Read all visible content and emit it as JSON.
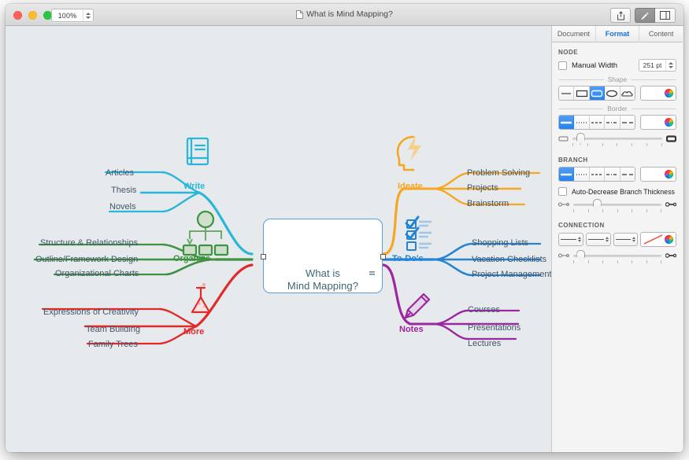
{
  "window": {
    "title": "What is Mind Mapping?",
    "zoom": "100%",
    "doc_icon": "document-icon",
    "traffic_lights": [
      "close",
      "minimize",
      "zoom"
    ],
    "toolbar_buttons": [
      {
        "name": "share-button",
        "icon": "share-icon",
        "active": false
      },
      {
        "name": "format-inspector-button",
        "icon": "pen-icon",
        "active": true
      },
      {
        "name": "sidebar-toggle-button",
        "icon": "sidebar-icon",
        "active": false
      }
    ]
  },
  "canvas": {
    "background": "#e6eaec",
    "center": {
      "label_line1": "What is",
      "label_line2": "Mind Mapping?",
      "icon": "lightbulb-icon",
      "border_color": "#5b9ed6",
      "text_color": "#3d6477",
      "selected": true,
      "collapse_icon": "collapse-icon"
    },
    "branches": [
      {
        "label": "Write",
        "color": "#29b6d8",
        "icon": "book-icon",
        "side": "left",
        "children": [
          "Articles",
          "Thesis",
          "Novels"
        ]
      },
      {
        "label": "Organize",
        "color": "#3f9242",
        "icon": "hierarchy-icon",
        "side": "left",
        "children": [
          "Structure & Relationships",
          "Outline/Framework Design",
          "Organizational Charts"
        ]
      },
      {
        "label": "More",
        "color": "#e02b2b",
        "icon": "flask-icon",
        "side": "left",
        "children": [
          "Expressions of Creativity",
          "Team Building",
          "Family Trees"
        ]
      },
      {
        "label": "Ideate",
        "color": "#f5a623",
        "icon": "head-lightning-icon",
        "side": "right",
        "children": [
          "Problem Solving",
          "Projects",
          "Brainstorm"
        ]
      },
      {
        "label": "To-Do's",
        "color": "#2483d4",
        "icon": "checklist-icon",
        "side": "right",
        "children": [
          "Shopping Lists",
          "Vacation Checklists",
          "Project Management"
        ]
      },
      {
        "label": "Notes",
        "color": "#9c27a0",
        "icon": "pencil-icon",
        "side": "right",
        "children": [
          "Courses",
          "Presentations",
          "Lectures"
        ]
      }
    ]
  },
  "inspector": {
    "tabs": [
      {
        "label": "Document",
        "active": false
      },
      {
        "label": "Format",
        "active": true
      },
      {
        "label": "Content",
        "active": false
      }
    ],
    "accent_color": "#1573d6",
    "node": {
      "section_title": "NODE",
      "manual_width_label": "Manual Width",
      "manual_width_checked": false,
      "width_value": "251 pt",
      "shape_group_label": "Shape",
      "shape_options": [
        "line",
        "rectangle",
        "rounded-rectangle",
        "ellipse",
        "cloud"
      ],
      "shape_selected_index": 2,
      "border_group_label": "Border",
      "border_options": [
        "solid",
        "dotted",
        "dashed",
        "dash-dot",
        "long-dash"
      ],
      "border_selected_index": 0,
      "border_width_value": 8
    },
    "branch": {
      "section_title": "BRANCH",
      "style_options": [
        "solid",
        "dotted",
        "dashed",
        "dash-dot",
        "long-dash"
      ],
      "style_selected_index": 0,
      "auto_decrease_label": "Auto-Decrease Branch Thickness",
      "auto_decrease_checked": false,
      "thickness_value": 22
    },
    "connection": {
      "section_title": "CONNECTION",
      "selects": [
        "line-start",
        "line-style",
        "line-end"
      ],
      "preview_color": "#e8604c",
      "width_value": 8
    }
  }
}
